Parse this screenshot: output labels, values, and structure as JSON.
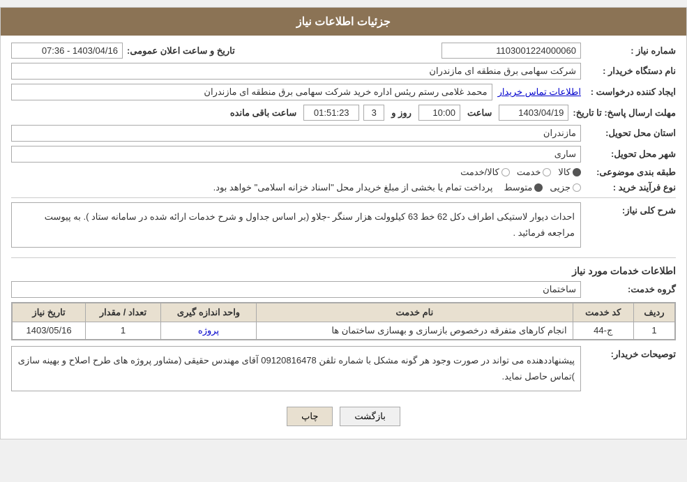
{
  "header": {
    "title": "جزئیات اطلاعات نیاز"
  },
  "fields": {
    "shomareNiaz_label": "شماره نیاز :",
    "shomareNiaz_value": "1103001224000060",
    "namDastgah_label": "نام دستگاه خریدار :",
    "namDastgah_value": "شرکت سهامی برق منطقه ای مازندران",
    "ejadKonande_label": "ایجاد کننده درخواست :",
    "ejadKonande_value": "محمد غلامی رستم ریئس اداره خرید شرکت سهامی برق منطقه ای مازندران",
    "ejadKonande_link": "اطلاعات تماس خریدار",
    "mohlatErsalPasokh_label": "مهلت ارسال پاسخ: تا تاریخ:",
    "mohlatDate": "1403/04/19",
    "mohlatSaat_label": "ساعت",
    "mohlatSaat": "10:00",
    "mohlatRooz_label": "روز و",
    "mohlatRooz": "3",
    "mohlatBaqi_label": "ساعت باقی مانده",
    "mohlatBaqiValue": "01:51:23",
    "tarikhElan_label": "تاریخ و ساعت اعلان عمومی:",
    "tarikhElan_value": "1403/04/16 - 07:36",
    "ostanTahvil_label": "استان محل تحویل:",
    "ostanTahvil_value": "مازندران",
    "shahrTahvil_label": "شهر محل تحویل:",
    "shahrTahvil_value": "ساری",
    "tabaqeBandi_label": "طبقه بندی موضوعی:",
    "tabaqeOptions": [
      "کالا",
      "خدمت",
      "کالا/خدمت"
    ],
    "tabaqeSelected": "کالا",
    "noeFarayand_label": "نوع فرآیند خرید :",
    "noeFarayandOptions": [
      "جزیی",
      "متوسط"
    ],
    "noeFarayandSelected": "متوسط",
    "noeFarayandNote": "پرداخت تمام یا بخشی از مبلغ خریدار محل \"اسناد خزانه اسلامی\" خواهد بود.",
    "sharhKoli_label": "شرح کلی نیاز:",
    "sharhKoli_value": "احداث دیوار لاستیکی اطراف دکل 62 خط 63 کیلوولت هزار سنگر -جلاو (بر اساس جداول و شرح خدمات ارائه شده در سامانه ستاد ). به پیوست مراجعه فرمائید .",
    "khadamatSection": "اطلاعات خدمات مورد نیاز",
    "gorohKhedmat_label": "گروه خدمت:",
    "gorohKhedmat_value": "ساختمان",
    "table": {
      "headers": [
        "ردیف",
        "کد خدمت",
        "نام خدمت",
        "واحد اندازه گیری",
        "تعداد / مقدار",
        "تاریخ نیاز"
      ],
      "rows": [
        {
          "radif": "1",
          "kodKhedmat": "ج-44",
          "namKhedmat": "انجام کارهای متفرقه درخصوص بازسازی و بهسازی ساختمان ها",
          "vahed": "پروژه",
          "tedad": "1",
          "tarikh": "1403/05/16"
        }
      ]
    },
    "tosihKharidar_label": "توصیحات خریدار:",
    "tosihKharidar_value": "پیشنهاددهنده می تواند در صورت وجود هر گونه مشکل با شماره تلفن 09120816478 آقای مهندس حقیقی  (مشاور پروژه های طرح اصلاح و بهینه سازی )تماس حاصل نماید.",
    "buttons": {
      "bazgasht": "بازگشت",
      "chap": "چاپ"
    }
  }
}
